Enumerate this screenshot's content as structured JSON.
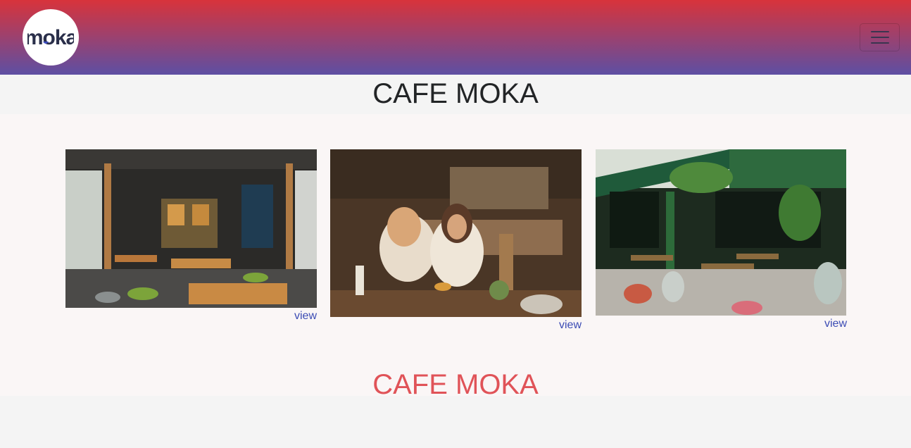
{
  "brand": {
    "logo_text": "moka",
    "accent": "#3b4cc0"
  },
  "navbar": {
    "gradient_top": "#d8333b",
    "gradient_bottom": "#5d4fa3",
    "toggle_icon": "hamburger-icon"
  },
  "header": {
    "title": "CAFE MOKA"
  },
  "gallery": {
    "cards": [
      {
        "image": "restaurant-interior-photo",
        "link_label": "view"
      },
      {
        "image": "two-women-cafe-photo",
        "link_label": "view"
      },
      {
        "image": "outdoor-terrace-photo",
        "link_label": "view"
      }
    ]
  },
  "footer": {
    "title": "CAFE MOKA",
    "color": "#e05358"
  }
}
